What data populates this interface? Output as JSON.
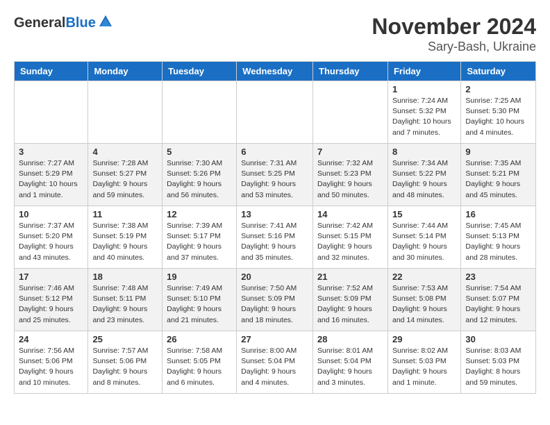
{
  "header": {
    "logo_general": "General",
    "logo_blue": "Blue",
    "title": "November 2024",
    "subtitle": "Sary-Bash, Ukraine"
  },
  "weekdays": [
    "Sunday",
    "Monday",
    "Tuesday",
    "Wednesday",
    "Thursday",
    "Friday",
    "Saturday"
  ],
  "weeks": [
    {
      "shade": false,
      "days": [
        {
          "num": "",
          "info": ""
        },
        {
          "num": "",
          "info": ""
        },
        {
          "num": "",
          "info": ""
        },
        {
          "num": "",
          "info": ""
        },
        {
          "num": "",
          "info": ""
        },
        {
          "num": "1",
          "info": "Sunrise: 7:24 AM\nSunset: 5:32 PM\nDaylight: 10 hours and 7 minutes."
        },
        {
          "num": "2",
          "info": "Sunrise: 7:25 AM\nSunset: 5:30 PM\nDaylight: 10 hours and 4 minutes."
        }
      ]
    },
    {
      "shade": true,
      "days": [
        {
          "num": "3",
          "info": "Sunrise: 7:27 AM\nSunset: 5:29 PM\nDaylight: 10 hours and 1 minute."
        },
        {
          "num": "4",
          "info": "Sunrise: 7:28 AM\nSunset: 5:27 PM\nDaylight: 9 hours and 59 minutes."
        },
        {
          "num": "5",
          "info": "Sunrise: 7:30 AM\nSunset: 5:26 PM\nDaylight: 9 hours and 56 minutes."
        },
        {
          "num": "6",
          "info": "Sunrise: 7:31 AM\nSunset: 5:25 PM\nDaylight: 9 hours and 53 minutes."
        },
        {
          "num": "7",
          "info": "Sunrise: 7:32 AM\nSunset: 5:23 PM\nDaylight: 9 hours and 50 minutes."
        },
        {
          "num": "8",
          "info": "Sunrise: 7:34 AM\nSunset: 5:22 PM\nDaylight: 9 hours and 48 minutes."
        },
        {
          "num": "9",
          "info": "Sunrise: 7:35 AM\nSunset: 5:21 PM\nDaylight: 9 hours and 45 minutes."
        }
      ]
    },
    {
      "shade": false,
      "days": [
        {
          "num": "10",
          "info": "Sunrise: 7:37 AM\nSunset: 5:20 PM\nDaylight: 9 hours and 43 minutes."
        },
        {
          "num": "11",
          "info": "Sunrise: 7:38 AM\nSunset: 5:19 PM\nDaylight: 9 hours and 40 minutes."
        },
        {
          "num": "12",
          "info": "Sunrise: 7:39 AM\nSunset: 5:17 PM\nDaylight: 9 hours and 37 minutes."
        },
        {
          "num": "13",
          "info": "Sunrise: 7:41 AM\nSunset: 5:16 PM\nDaylight: 9 hours and 35 minutes."
        },
        {
          "num": "14",
          "info": "Sunrise: 7:42 AM\nSunset: 5:15 PM\nDaylight: 9 hours and 32 minutes."
        },
        {
          "num": "15",
          "info": "Sunrise: 7:44 AM\nSunset: 5:14 PM\nDaylight: 9 hours and 30 minutes."
        },
        {
          "num": "16",
          "info": "Sunrise: 7:45 AM\nSunset: 5:13 PM\nDaylight: 9 hours and 28 minutes."
        }
      ]
    },
    {
      "shade": true,
      "days": [
        {
          "num": "17",
          "info": "Sunrise: 7:46 AM\nSunset: 5:12 PM\nDaylight: 9 hours and 25 minutes."
        },
        {
          "num": "18",
          "info": "Sunrise: 7:48 AM\nSunset: 5:11 PM\nDaylight: 9 hours and 23 minutes."
        },
        {
          "num": "19",
          "info": "Sunrise: 7:49 AM\nSunset: 5:10 PM\nDaylight: 9 hours and 21 minutes."
        },
        {
          "num": "20",
          "info": "Sunrise: 7:50 AM\nSunset: 5:09 PM\nDaylight: 9 hours and 18 minutes."
        },
        {
          "num": "21",
          "info": "Sunrise: 7:52 AM\nSunset: 5:09 PM\nDaylight: 9 hours and 16 minutes."
        },
        {
          "num": "22",
          "info": "Sunrise: 7:53 AM\nSunset: 5:08 PM\nDaylight: 9 hours and 14 minutes."
        },
        {
          "num": "23",
          "info": "Sunrise: 7:54 AM\nSunset: 5:07 PM\nDaylight: 9 hours and 12 minutes."
        }
      ]
    },
    {
      "shade": false,
      "days": [
        {
          "num": "24",
          "info": "Sunrise: 7:56 AM\nSunset: 5:06 PM\nDaylight: 9 hours and 10 minutes."
        },
        {
          "num": "25",
          "info": "Sunrise: 7:57 AM\nSunset: 5:06 PM\nDaylight: 9 hours and 8 minutes."
        },
        {
          "num": "26",
          "info": "Sunrise: 7:58 AM\nSunset: 5:05 PM\nDaylight: 9 hours and 6 minutes."
        },
        {
          "num": "27",
          "info": "Sunrise: 8:00 AM\nSunset: 5:04 PM\nDaylight: 9 hours and 4 minutes."
        },
        {
          "num": "28",
          "info": "Sunrise: 8:01 AM\nSunset: 5:04 PM\nDaylight: 9 hours and 3 minutes."
        },
        {
          "num": "29",
          "info": "Sunrise: 8:02 AM\nSunset: 5:03 PM\nDaylight: 9 hours and 1 minute."
        },
        {
          "num": "30",
          "info": "Sunrise: 8:03 AM\nSunset: 5:03 PM\nDaylight: 8 hours and 59 minutes."
        }
      ]
    }
  ]
}
